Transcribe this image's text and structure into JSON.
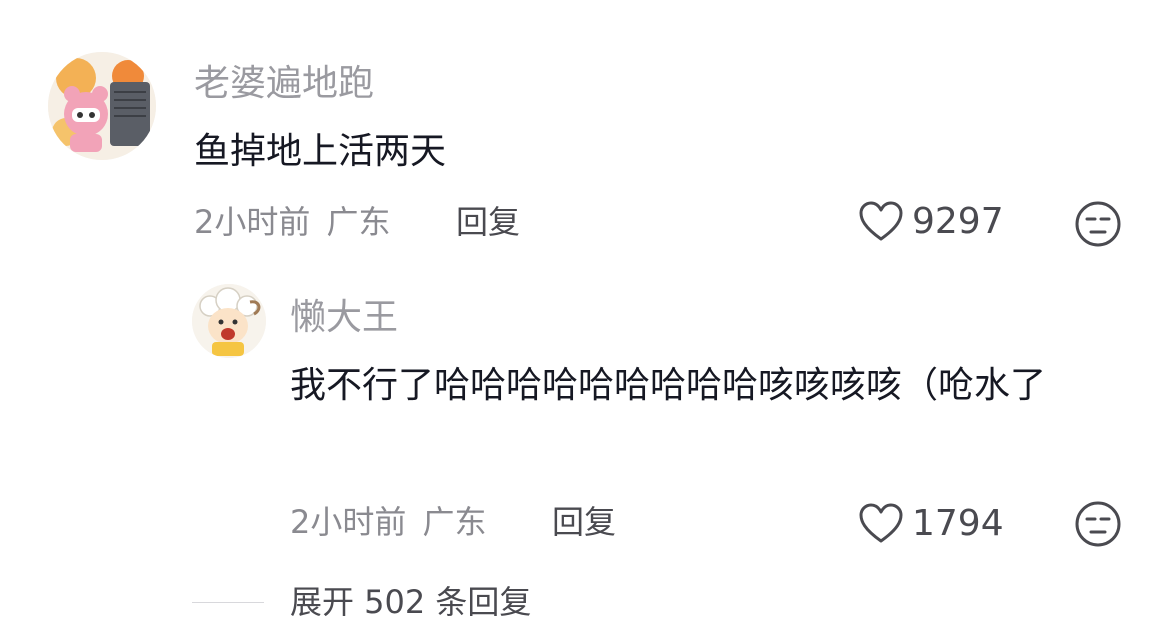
{
  "comment": {
    "username": "老婆遍地跑",
    "text": "鱼掉地上活两天",
    "time": "2小时前",
    "location": "广东",
    "reply_label": "回复",
    "likes": "9297",
    "avatar_icon": "pink-character-avatar",
    "heart_icon": "heart-outline-icon",
    "dislike_icon": "unamused-face-icon"
  },
  "reply": {
    "username": "懒大王",
    "text": "我不行了哈哈哈哈哈哈哈哈哈咳咳咳咳（呛水了",
    "time": "2小时前",
    "location": "广东",
    "reply_label": "回复",
    "likes": "1794",
    "avatar_icon": "sheep-avatar",
    "heart_icon": "heart-outline-icon",
    "dislike_icon": "unamused-face-icon"
  },
  "expand": {
    "label": "展开 502 条回复"
  },
  "colors": {
    "username": "#9a9aa0",
    "text": "#161823",
    "meta": "#8a8a90",
    "action": "#4a4a50"
  }
}
